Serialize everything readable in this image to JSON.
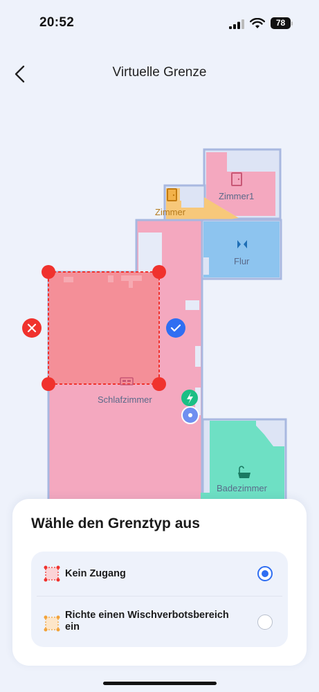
{
  "status_bar": {
    "time": "20:52",
    "battery": "78"
  },
  "header": {
    "title": "Virtuelle Grenze",
    "back_icon": "chevron-left-icon"
  },
  "map": {
    "rooms": {
      "zimmer1": "Zimmer1",
      "zimmer": "Zimmer",
      "flur": "Flur",
      "schlafzimmer": "Schlafzimmer",
      "badezimmer": "Badezimmer"
    },
    "colors": {
      "pink": "#f4a8bf",
      "blue": "#8dc4ef",
      "green": "#6ee0c4",
      "yellow": "#f7c87a",
      "zone": "#f48f98",
      "handle": "#f0322d",
      "confirm": "#2f6ef2"
    }
  },
  "sheet": {
    "title": "Wähle den Grenztyp aus",
    "options": [
      {
        "label": "Kein Zugang",
        "selected": true
      },
      {
        "label_line1": "Richte einen Wischverbotsbereich",
        "label_line2": "ein",
        "selected": false
      }
    ]
  }
}
